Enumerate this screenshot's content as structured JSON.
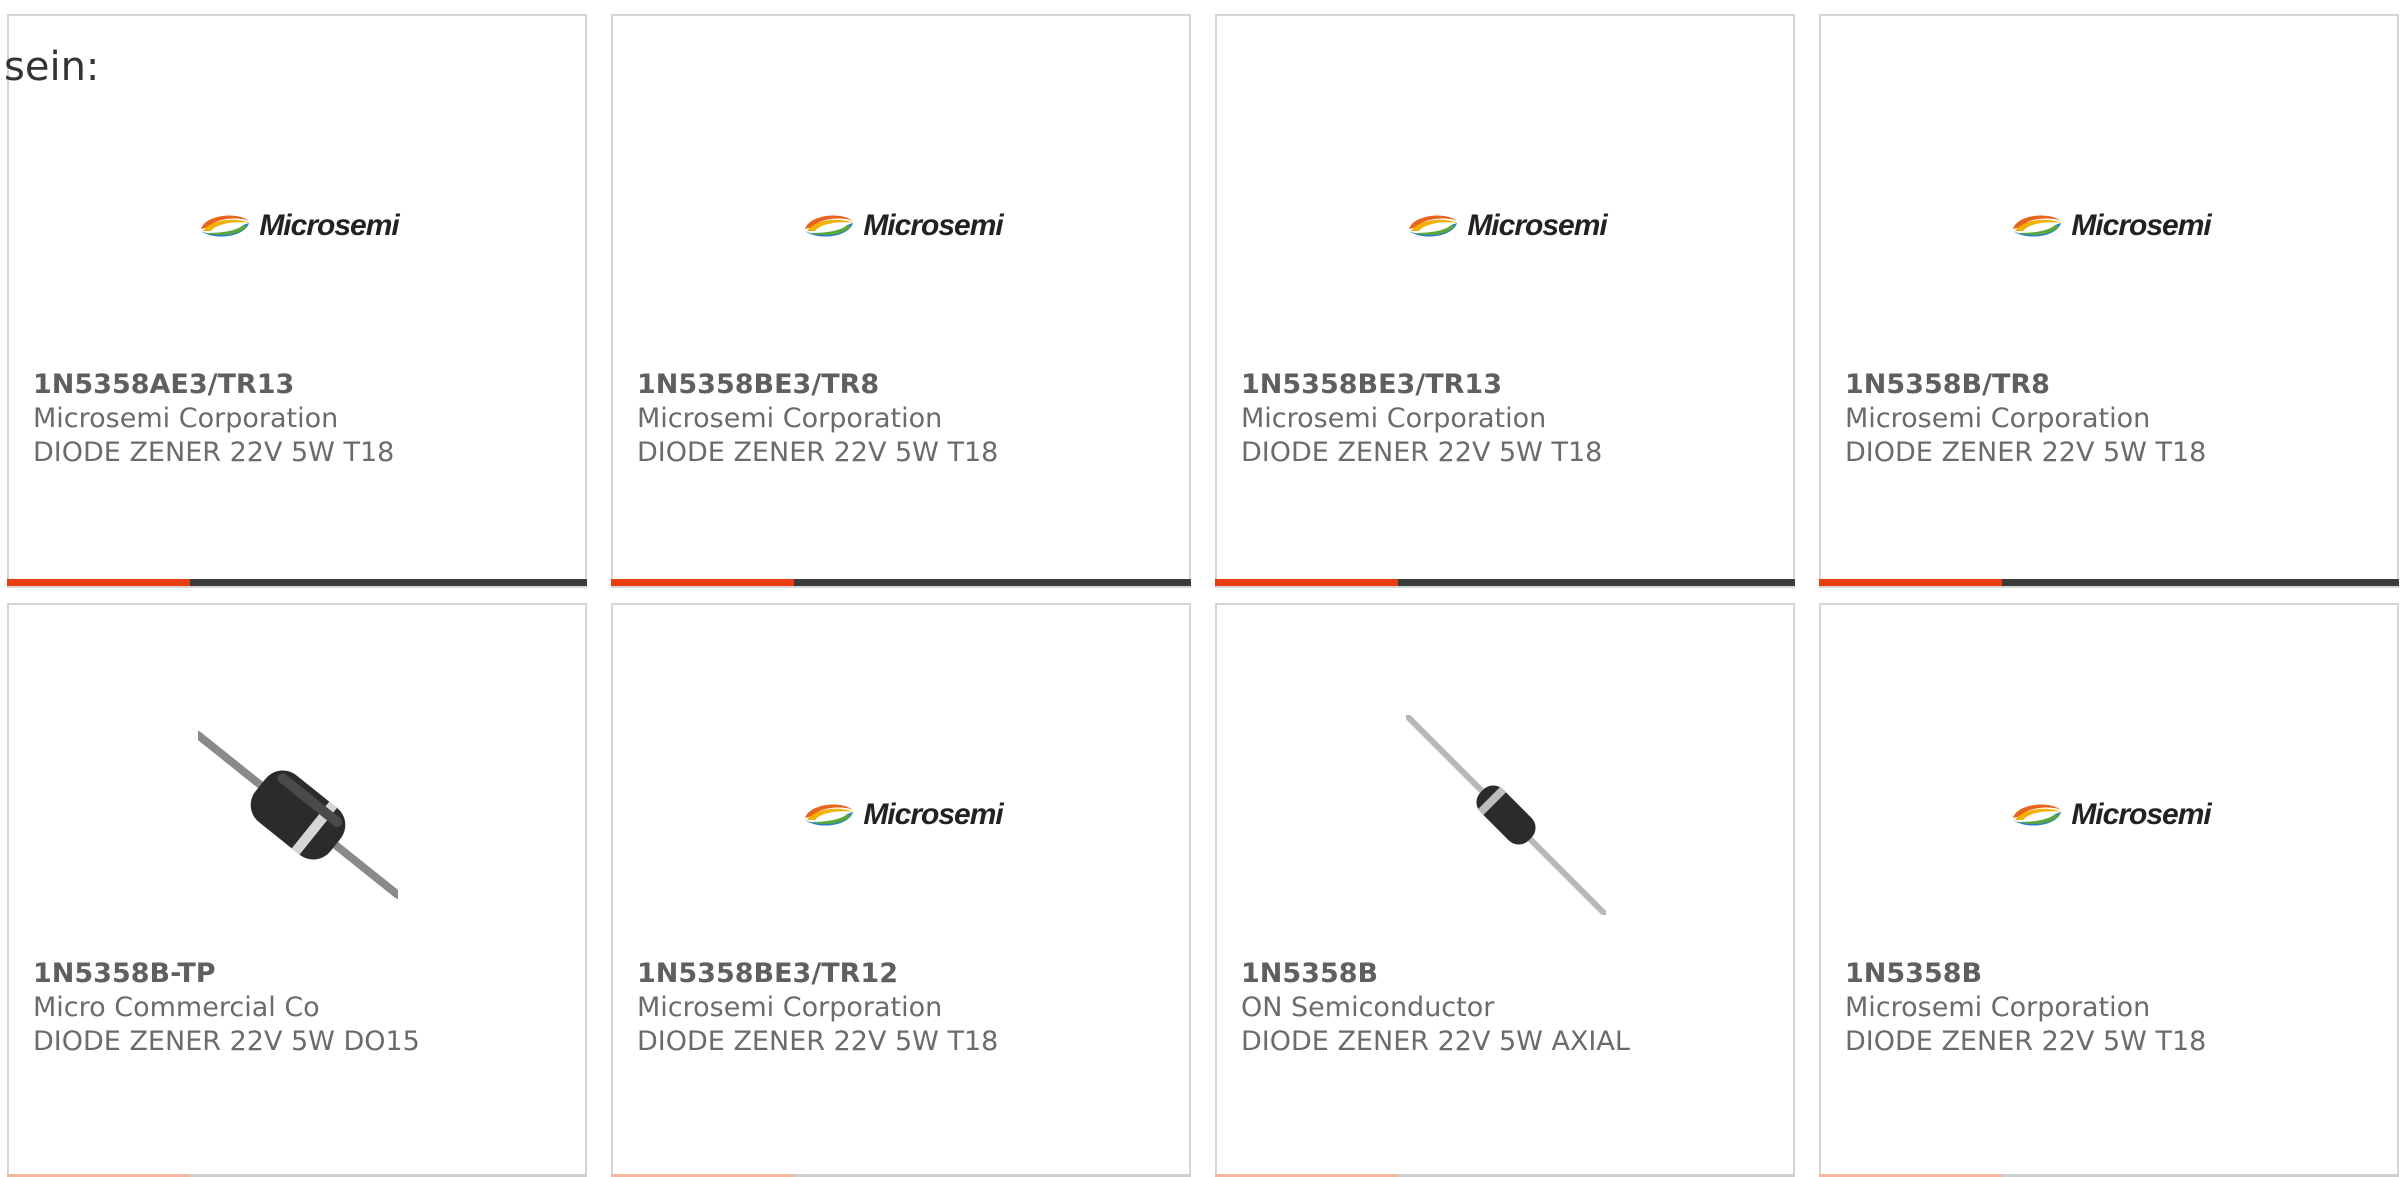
{
  "intro_text": "sein:",
  "logo_text": "Microsemi",
  "colors": {
    "accent": "#e83e0f",
    "bar_dark": "#3b3b3b",
    "card_border": "#d6d6d6",
    "text": "#6b6b6b"
  },
  "products": [
    {
      "part_number": "1N5358AE3/TR13",
      "manufacturer": "Microsemi Corporation",
      "description": "DIODE ZENER 22V 5W T18",
      "image": "microsemi-logo"
    },
    {
      "part_number": "1N5358BE3/TR8",
      "manufacturer": "Microsemi Corporation",
      "description": "DIODE ZENER 22V 5W T18",
      "image": "microsemi-logo"
    },
    {
      "part_number": "1N5358BE3/TR13",
      "manufacturer": "Microsemi Corporation",
      "description": "DIODE ZENER 22V 5W T18",
      "image": "microsemi-logo"
    },
    {
      "part_number": "1N5358B/TR8",
      "manufacturer": "Microsemi Corporation",
      "description": "DIODE ZENER 22V 5W T18",
      "image": "microsemi-logo"
    },
    {
      "part_number": "1N5358B-TP",
      "manufacturer": "Micro Commercial Co",
      "description": "DIODE ZENER 22V 5W DO15",
      "image": "diode-do15-photo"
    },
    {
      "part_number": "1N5358BE3/TR12",
      "manufacturer": "Microsemi Corporation",
      "description": "DIODE ZENER 22V 5W T18",
      "image": "microsemi-logo"
    },
    {
      "part_number": "1N5358B",
      "manufacturer": "ON Semiconductor",
      "description": "DIODE ZENER 22V 5W AXIAL",
      "image": "diode-axial-photo"
    },
    {
      "part_number": "1N5358B",
      "manufacturer": "Microsemi Corporation",
      "description": "DIODE ZENER 22V 5W T18",
      "image": "microsemi-logo"
    }
  ]
}
